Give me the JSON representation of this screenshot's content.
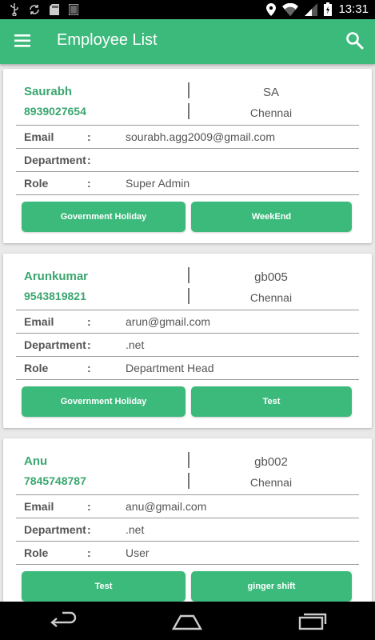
{
  "status_bar": {
    "time": "13:31",
    "left_icons": [
      "usb-icon",
      "sync-icon",
      "sd-card-icon",
      "barcode-icon"
    ],
    "right_icons": [
      "location-icon",
      "wifi-icon",
      "signal-icon",
      "battery-icon"
    ]
  },
  "app_bar": {
    "title": "Employee List",
    "menu_icon": "hamburger-menu-icon",
    "search_icon": "search-icon"
  },
  "labels": {
    "email": "Email",
    "department": "Department",
    "role": "Role",
    "colon": ":"
  },
  "employees": [
    {
      "name": "Saurabh",
      "phone": "8939027654",
      "code": "SA",
      "city": "Chennai",
      "email": "sourabh.agg2009@gmail.com",
      "department": "",
      "role": "Super Admin",
      "button_left": "Government Holiday",
      "button_right": "WeekEnd"
    },
    {
      "name": "Arunkumar",
      "phone": "9543819821",
      "code": "gb005",
      "city": "Chennai",
      "email": "arun@gmail.com",
      "department": ".net",
      "role": "Department Head",
      "button_left": "Government Holiday",
      "button_right": "Test"
    },
    {
      "name": "Anu",
      "phone": "7845748787",
      "code": "gb002",
      "city": "Chennai",
      "email": "anu@gmail.com",
      "department": ".net",
      "role": "User",
      "button_left": "Test",
      "button_right": "ginger shift"
    }
  ],
  "nav_bar": {
    "icons": [
      "back-icon",
      "home-icon",
      "recent-apps-icon"
    ]
  },
  "colors": {
    "accent": "#3cba7c",
    "accent_text": "#3aa66f",
    "status_bar": "#000000",
    "nav_bar": "#000000"
  }
}
